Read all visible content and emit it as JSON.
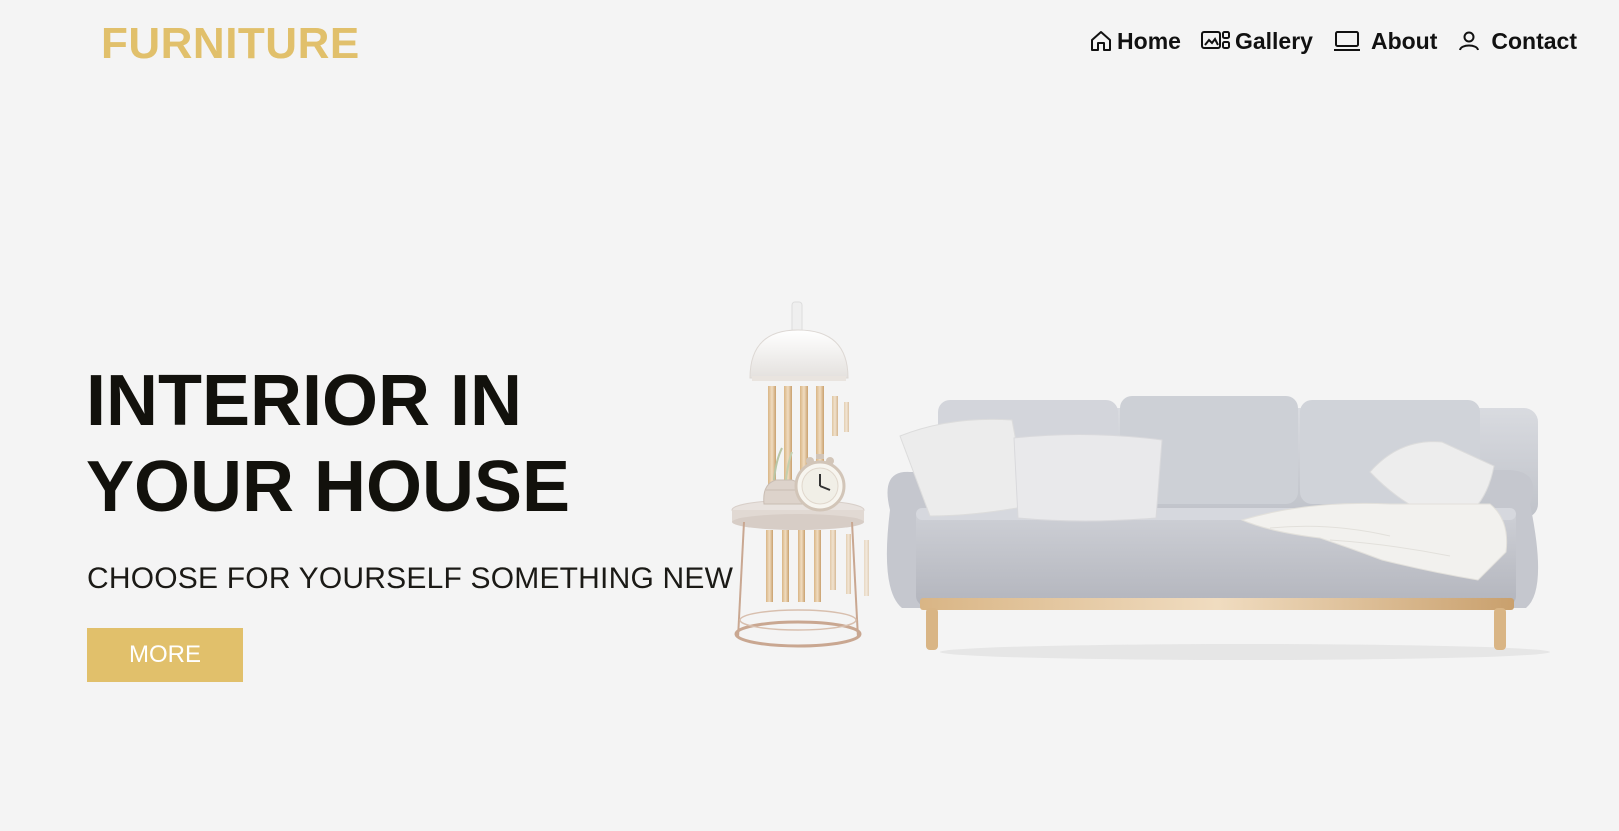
{
  "brand": {
    "logo_text": "FURNITURE"
  },
  "nav": {
    "items": [
      {
        "label": "Home",
        "icon": "home-icon"
      },
      {
        "label": "Gallery",
        "icon": "gallery-icon"
      },
      {
        "label": "About",
        "icon": "laptop-icon"
      },
      {
        "label": "Contact",
        "icon": "user-icon"
      }
    ]
  },
  "hero": {
    "title_line1": "INTERIOR IN",
    "title_line2": "YOUR HOUSE",
    "subtitle": "CHOOSE FOR YOURSELF SOMETHING NEW",
    "cta_label": "MORE",
    "image": "sofa-with-side-table-and-lamp"
  },
  "colors": {
    "accent": "#e1c06b",
    "background": "#f4f4f4",
    "text": "#12110c"
  }
}
